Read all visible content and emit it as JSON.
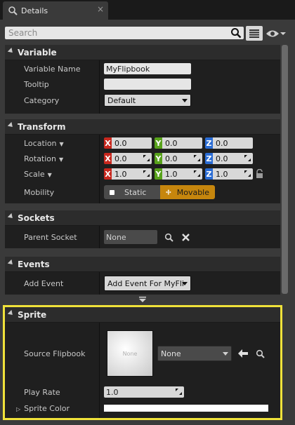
{
  "tab": {
    "title": "Details",
    "close": "×"
  },
  "toolbar": {
    "search_placeholder": "Search"
  },
  "variable": {
    "header": "Variable",
    "name_label": "Variable Name",
    "name_value": "MyFlipbook",
    "tooltip_label": "Tooltip",
    "tooltip_value": "",
    "category_label": "Category",
    "category_value": "Default"
  },
  "transform": {
    "header": "Transform",
    "location_label": "Location",
    "rotation_label": "Rotation",
    "scale_label": "Scale",
    "mobility_label": "Mobility",
    "axis_x": "X",
    "axis_y": "Y",
    "axis_z": "Z",
    "location": [
      "0.0",
      "0.0",
      "0.0"
    ],
    "rotation": [
      "0.0",
      "0.0",
      "0.0"
    ],
    "scale": [
      "1.0",
      "1.0",
      "1.0"
    ],
    "mobility_static": "Static",
    "mobility_movable": "Movable"
  },
  "sockets": {
    "header": "Sockets",
    "parent_label": "Parent Socket",
    "parent_value": "None"
  },
  "events": {
    "header": "Events",
    "add_label": "Add Event",
    "add_value": "Add Event For MyFli"
  },
  "sprite": {
    "header": "Sprite",
    "source_label": "Source Flipbook",
    "thumb_text": "None",
    "source_value": "None",
    "rate_label": "Play Rate",
    "rate_value": "1.0",
    "color_label": "Sprite Color",
    "color_value": "#ffffff"
  },
  "colors": {
    "highlight": "#f0e23a",
    "movable": "#c6860d",
    "x": "#c8281e",
    "y": "#58a21b",
    "z": "#2a6cd4"
  }
}
